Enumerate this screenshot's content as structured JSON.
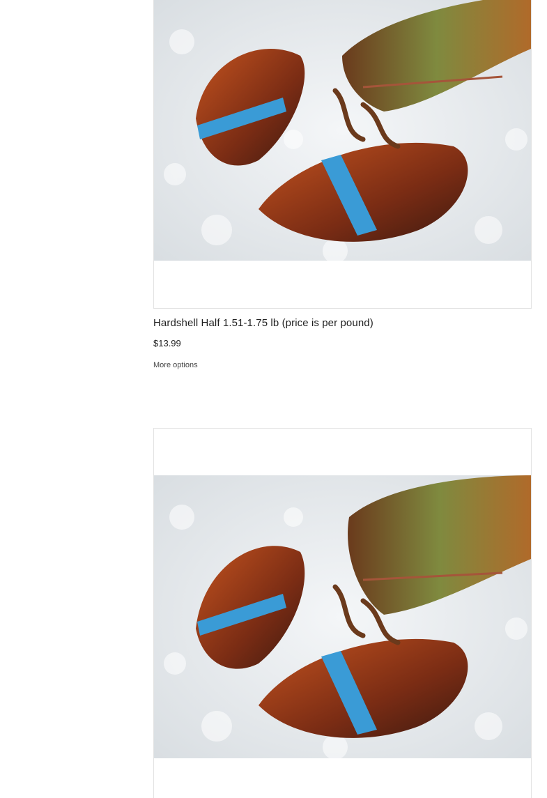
{
  "products": [
    {
      "title": "Hardshell Half 1.51-1.75 lb (price is per pound)",
      "price": "$13.99",
      "more_options_label": "More options",
      "image_alt": "Live lobster on ice with blue claw bands"
    },
    {
      "image_alt": "Live lobster on ice with blue claw bands"
    }
  ],
  "colors": {
    "ice": "#e9edf0",
    "band": "#3a9bd6",
    "shell_dark": "#5a2a18",
    "shell_red": "#b8461d",
    "shell_green": "#6b7a3a"
  }
}
